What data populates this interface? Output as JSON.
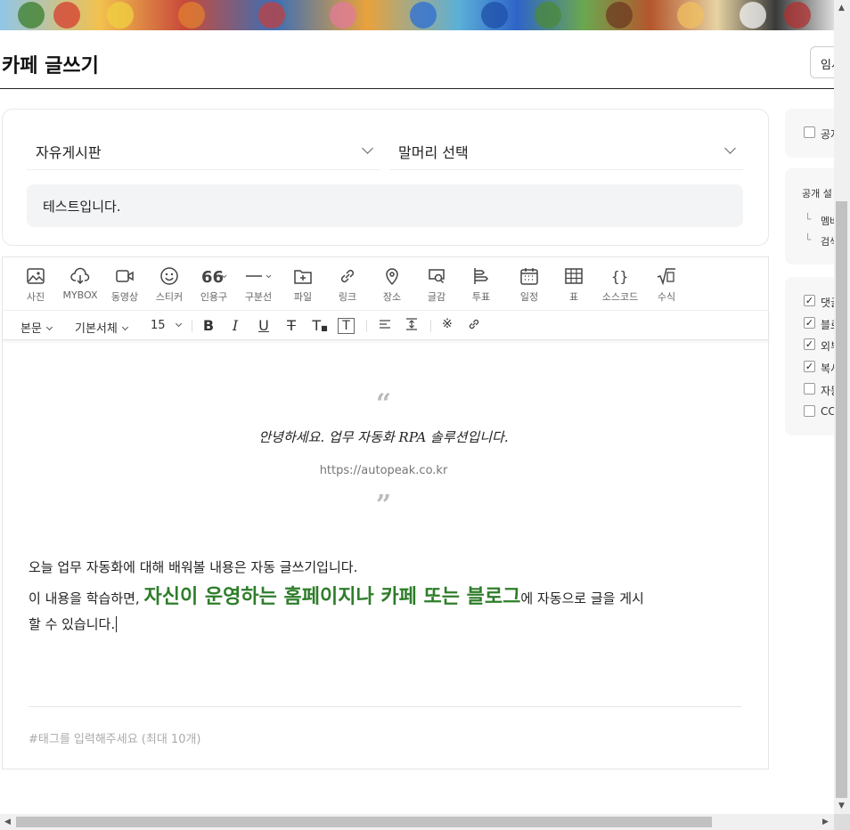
{
  "header": {
    "title": "카페 글쓰기",
    "temp_save_label": "임시"
  },
  "form": {
    "board_select": "자유게시판",
    "prefix_select": "말머리 선택",
    "title_value": "테스트입니다."
  },
  "toolbar": {
    "items": [
      {
        "icon": "photo-icon",
        "label": "사진"
      },
      {
        "icon": "mybox-icon",
        "label": "MYBOX"
      },
      {
        "icon": "video-icon",
        "label": "동영상"
      },
      {
        "icon": "sticker-icon",
        "label": "스티커"
      },
      {
        "icon": "quote-icon",
        "label": "인용구"
      },
      {
        "icon": "divider-icon",
        "label": "구분선"
      },
      {
        "icon": "file-icon",
        "label": "파일"
      },
      {
        "icon": "link-icon",
        "label": "링크"
      },
      {
        "icon": "place-icon",
        "label": "장소"
      },
      {
        "icon": "material-icon",
        "label": "글감"
      },
      {
        "icon": "vote-icon",
        "label": "투표"
      },
      {
        "icon": "schedule-icon",
        "label": "일정"
      },
      {
        "icon": "table-icon",
        "label": "표"
      },
      {
        "icon": "source-code-icon",
        "label": "소스코드"
      },
      {
        "icon": "formula-icon",
        "label": "수식"
      }
    ],
    "style_select": "본문",
    "font_select": "기본서체",
    "size_select": "15"
  },
  "editor": {
    "quote_text": "안녕하세요. 업무 자동화 RPA 솔루션입니다.",
    "quote_source": "https://autopeak.co.kr",
    "line1": "오늘 업무 자동화에 대해 배워볼 내용은 자동 글쓰기입니다.",
    "line2_before": "이 내용을 학습하면, ",
    "line2_highlight": "자신이 운영하는 홈페이지나 카페 또는 블로그",
    "line2_after": "에 자동으로 글을 게시",
    "line3": "할 수 있습니다.",
    "tag_placeholder": "#태그를 입력해주세요 (최대 10개)"
  },
  "sidebar": {
    "notice_label": "공지",
    "public_setting_label": "공개 설",
    "public_options": [
      "멤버",
      "검색"
    ],
    "options": [
      {
        "label": "댓글",
        "checked": true
      },
      {
        "label": "블로그",
        "checked": true
      },
      {
        "label": "외부",
        "checked": true
      },
      {
        "label": "복사",
        "checked": true
      },
      {
        "label": "자동",
        "checked": false
      },
      {
        "label": "CCL",
        "checked": false
      }
    ]
  },
  "colors": {
    "highlight": "#2e7d2a",
    "title_bg": "#f3f4f6"
  }
}
